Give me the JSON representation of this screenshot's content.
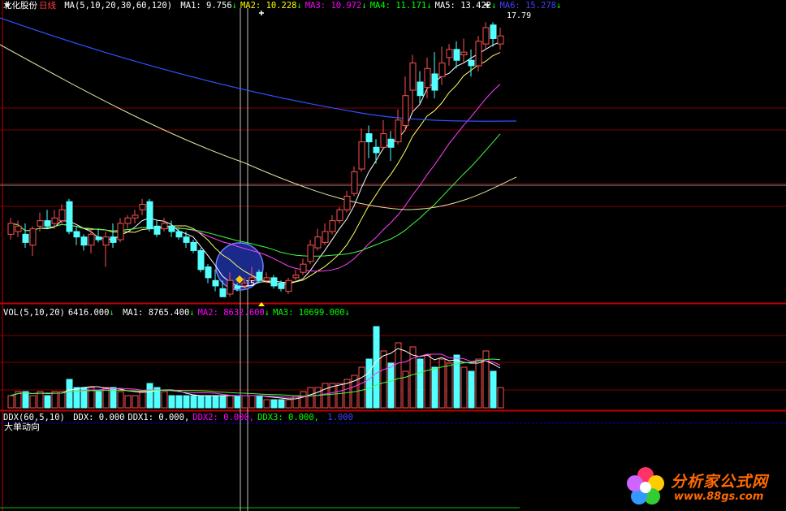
{
  "stock": {
    "name": "北化股份",
    "period": "日线"
  },
  "price_header": {
    "indicator": "MA(5,10,20,30,60,120)",
    "items": [
      {
        "label": "MA1:",
        "value": "9.756",
        "arrow": "↓",
        "color": "#ffffff"
      },
      {
        "label": "MA2:",
        "value": "10.228",
        "arrow": "↓",
        "color": "#ffff00"
      },
      {
        "label": "MA3:",
        "value": "10.972",
        "arrow": "↓",
        "color": "#ff00ff"
      },
      {
        "label": "MA4:",
        "value": "11.171",
        "arrow": "↓",
        "color": "#00ff00"
      },
      {
        "label": "MA5:",
        "value": "13.422",
        "arrow": "↓",
        "color": "#ffffff"
      },
      {
        "label": "MA6:",
        "value": "15.278",
        "arrow": "↓",
        "color": "#4040ff"
      }
    ]
  },
  "vol_header": {
    "indicator": "VOL(5,10,20)",
    "value": "6416.000",
    "arrow": "↓",
    "items": [
      {
        "label": "MA1:",
        "value": "8765.400",
        "arrow": "↓",
        "color": "#ffffff"
      },
      {
        "label": "MA2:",
        "value": "8632.600",
        "arrow": "↓",
        "color": "#ff00ff"
      },
      {
        "label": "MA3:",
        "value": "10699.000",
        "arrow": "↓",
        "color": "#00ff00"
      }
    ]
  },
  "ddx_header": {
    "indicator": "DDX(60,5,10)",
    "items": [
      {
        "label": "DDX:",
        "value": "0.000",
        "color": "#ffffff"
      },
      {
        "label": "DDX1:",
        "value": "0.000,",
        "color": "#ffffff"
      },
      {
        "label": "DDX2:",
        "value": "0.000,",
        "color": "#ff00ff"
      },
      {
        "label": "DDX3:",
        "value": "0.000,",
        "color": "#00ff00"
      },
      {
        "label": "",
        "value": "1.000",
        "color": "#4040ff"
      }
    ],
    "subtitle": "大单动向"
  },
  "annotations": {
    "high_label": "17.79",
    "low_label": "15"
  },
  "logo": {
    "text": "分析家公式网",
    "url": "www.88gs.com"
  },
  "colors": {
    "up": "#ff5050",
    "down": "#54ffff",
    "grid": "#800000",
    "axis": "#c00000"
  },
  "chart_data": {
    "type": "candlestick",
    "ylim": [
      7.5,
      18.2
    ],
    "candles": [
      [
        10.0,
        10.4,
        10.6,
        9.8
      ],
      [
        10.1,
        10.3,
        10.5,
        9.9
      ],
      [
        10.0,
        9.7,
        10.4,
        9.5
      ],
      [
        9.6,
        10.2,
        10.3,
        9.2
      ],
      [
        10.3,
        10.5,
        10.8,
        10.1
      ],
      [
        10.5,
        10.3,
        10.9,
        10.2
      ],
      [
        10.4,
        10.6,
        10.9,
        10.2
      ],
      [
        10.5,
        10.9,
        11.1,
        10.4
      ],
      [
        11.2,
        10.1,
        11.3,
        10.0
      ],
      [
        10.1,
        9.9,
        10.3,
        9.6
      ],
      [
        9.9,
        9.6,
        10.0,
        9.4
      ],
      [
        9.6,
        10.0,
        10.2,
        9.3
      ],
      [
        9.9,
        9.8,
        10.2,
        9.7
      ],
      [
        9.6,
        9.9,
        10.1,
        8.8
      ],
      [
        9.9,
        9.7,
        10.4,
        9.5
      ],
      [
        9.8,
        10.4,
        10.6,
        9.7
      ],
      [
        10.4,
        10.6,
        10.7,
        10.2
      ],
      [
        10.6,
        10.7,
        10.9,
        10.4
      ],
      [
        10.9,
        11.1,
        11.3,
        10.7
      ],
      [
        11.2,
        10.2,
        11.3,
        10.1
      ],
      [
        10.3,
        10.0,
        10.5,
        9.9
      ],
      [
        10.2,
        10.4,
        10.6,
        10.1
      ],
      [
        10.3,
        10.1,
        10.5,
        9.9
      ],
      [
        10.1,
        9.9,
        10.2,
        9.8
      ],
      [
        9.9,
        9.7,
        10.1,
        9.5
      ],
      [
        9.7,
        9.4,
        9.8,
        9.3
      ],
      [
        9.4,
        8.7,
        9.5,
        8.6
      ],
      [
        8.8,
        8.4,
        8.9,
        8.2
      ],
      [
        8.3,
        8.1,
        8.7,
        7.9
      ],
      [
        8.0,
        7.7,
        8.3,
        7.7
      ],
      [
        7.8,
        8.3,
        8.6,
        7.7
      ],
      [
        8.1,
        8.0,
        8.2,
        7.9
      ],
      [
        8.1,
        8.2,
        8.4,
        8.0
      ],
      [
        8.3,
        8.4,
        8.8,
        8.2
      ],
      [
        8.6,
        8.3,
        8.7,
        8.2
      ],
      [
        8.3,
        8.4,
        8.6,
        8.2
      ],
      [
        8.4,
        8.1,
        8.5,
        8.0
      ],
      [
        8.2,
        8.0,
        8.3,
        7.9
      ],
      [
        7.9,
        8.3,
        8.4,
        7.8
      ],
      [
        8.4,
        8.5,
        8.7,
        8.3
      ],
      [
        8.6,
        8.9,
        9.1,
        8.5
      ],
      [
        9.0,
        9.6,
        9.8,
        8.9
      ],
      [
        9.5,
        9.9,
        10.2,
        9.4
      ],
      [
        9.7,
        10.1,
        10.4,
        9.6
      ],
      [
        10.1,
        10.5,
        10.7,
        10.0
      ],
      [
        10.5,
        10.9,
        11.0,
        10.4
      ],
      [
        10.9,
        11.4,
        11.6,
        10.8
      ],
      [
        11.5,
        12.3,
        12.5,
        11.4
      ],
      [
        12.4,
        13.4,
        13.9,
        12.3
      ],
      [
        13.7,
        13.4,
        14.0,
        12.8
      ],
      [
        13.2,
        13.0,
        13.5,
        12.6
      ],
      [
        13.2,
        13.7,
        14.2,
        13.1
      ],
      [
        13.5,
        13.2,
        13.8,
        12.7
      ],
      [
        13.4,
        14.2,
        14.6,
        13.3
      ],
      [
        14.0,
        15.1,
        15.8,
        13.8
      ],
      [
        15.3,
        16.3,
        16.6,
        14.5
      ],
      [
        15.6,
        15.1,
        16.0,
        14.8
      ],
      [
        15.4,
        16.1,
        16.5,
        15.0
      ],
      [
        15.9,
        15.3,
        16.7,
        15.0
      ],
      [
        15.8,
        16.3,
        16.9,
        15.5
      ],
      [
        16.5,
        16.8,
        17.0,
        16.2
      ],
      [
        16.8,
        16.4,
        17.1,
        16.1
      ],
      [
        16.6,
        16.7,
        17.2,
        16.3
      ],
      [
        16.4,
        16.2,
        16.8,
        15.8
      ],
      [
        16.2,
        17.1,
        17.3,
        16.0
      ],
      [
        17.0,
        17.6,
        17.8,
        16.8
      ],
      [
        17.7,
        17.2,
        17.8,
        16.9
      ],
      [
        17.0,
        17.3,
        17.6,
        16.8
      ]
    ],
    "volume": [
      3,
      4,
      4,
      3,
      4,
      3,
      4,
      4,
      7,
      5,
      5,
      5,
      4,
      5,
      5,
      4,
      3,
      3,
      4,
      6,
      5,
      4,
      3,
      3,
      3,
      3,
      3,
      3,
      3,
      3,
      3,
      3,
      3,
      3,
      3,
      2,
      2,
      2,
      2,
      3,
      4,
      5,
      5,
      6,
      6,
      6,
      7,
      8,
      10,
      12,
      20,
      14,
      11,
      16,
      9,
      15,
      12,
      13,
      10,
      12,
      11,
      13,
      10,
      9,
      12,
      14,
      9,
      5
    ],
    "vol_ylim": [
      0,
      22
    ]
  }
}
